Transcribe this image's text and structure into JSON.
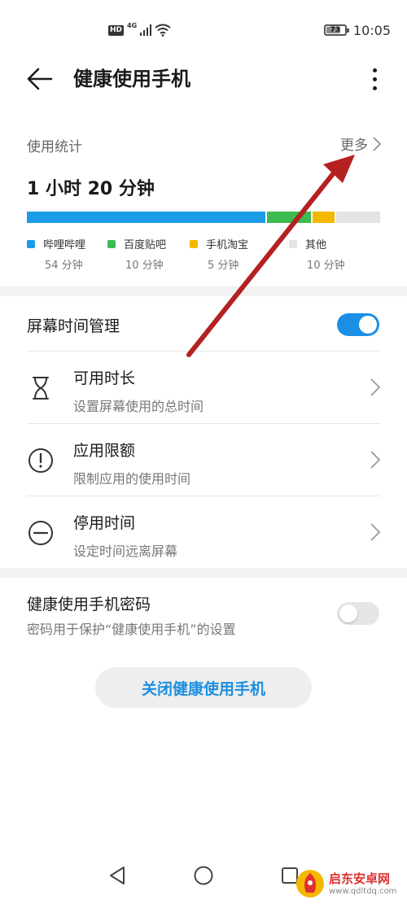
{
  "status_bar": {
    "hd": "HD",
    "network": "4G",
    "battery": "73",
    "time": "10:05"
  },
  "app_bar": {
    "title": "健康使用手机",
    "back_icon": "arrow-left-icon",
    "menu_icon": "more-vertical-icon"
  },
  "usage": {
    "section_label": "使用统计",
    "more_label": "更多",
    "total": "1 小时 20 分钟",
    "apps": [
      {
        "name": "哔哩哔哩",
        "time": "54 分钟",
        "minutes": 54,
        "color": "#1b9ce6"
      },
      {
        "name": "百度贴吧",
        "time": "10 分钟",
        "minutes": 10,
        "color": "#3dbb50"
      },
      {
        "name": "手机淘宝",
        "time": "5 分钟",
        "minutes": 5,
        "color": "#f5b800"
      },
      {
        "name": "其他",
        "time": "10 分钟",
        "minutes": 10,
        "color": "#e3e3e3"
      }
    ]
  },
  "screen_time": {
    "title": "屏幕时间管理",
    "enabled": true,
    "toggle_on_color": "#1b8fe6",
    "items": [
      {
        "title": "可用时长",
        "subtitle": "设置屏幕使用的总时间",
        "icon": "hourglass-icon"
      },
      {
        "title": "应用限额",
        "subtitle": "限制应用的使用时间",
        "icon": "alert-circle-icon"
      },
      {
        "title": "停用时间",
        "subtitle": "设定时间远离屏幕",
        "icon": "minus-circle-icon"
      }
    ]
  },
  "password": {
    "title": "健康使用手机密码",
    "subtitle": "密码用于保护“健康使用手机”的设置",
    "enabled": false
  },
  "close_button": "关闭健康使用手机",
  "accent_color": "#1d8fe0",
  "annotation_color": "#b52020",
  "watermark": {
    "title": "启东安卓网",
    "url": "www.qdltdq.com"
  }
}
